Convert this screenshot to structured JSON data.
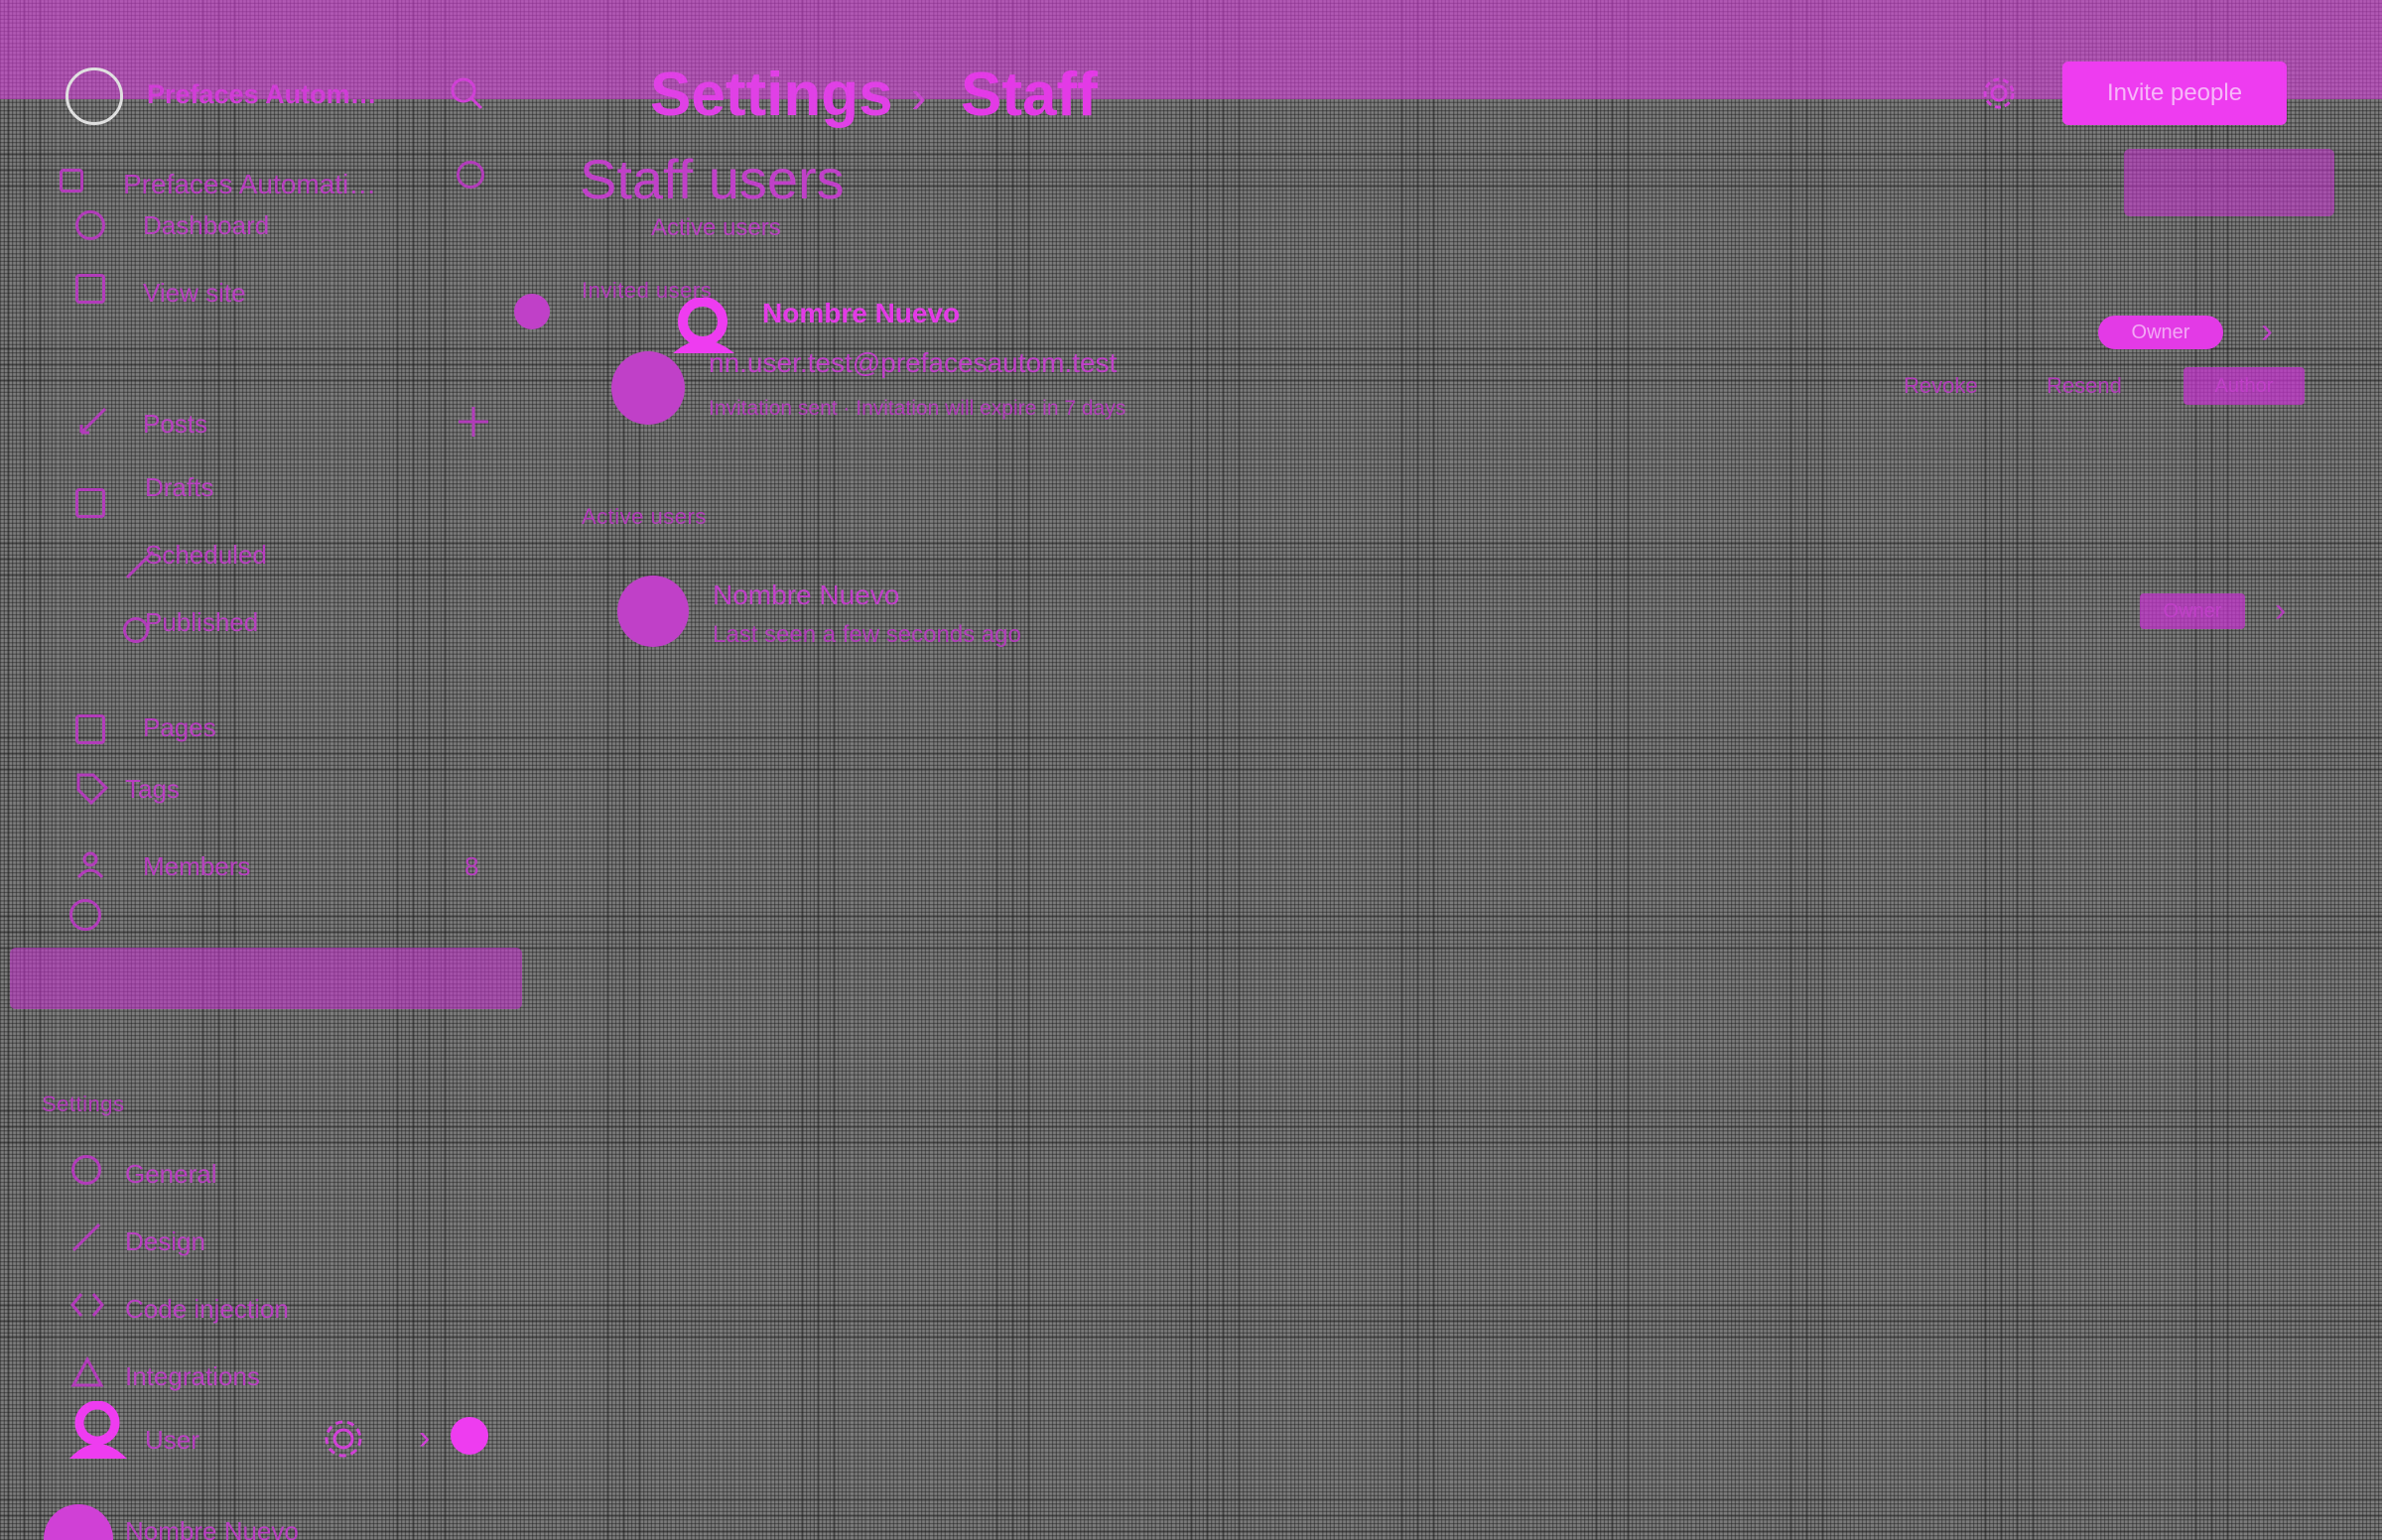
{
  "topbar": {
    "site_name": "Prefaces Autom…",
    "breadcrumb_parent": "Settings",
    "breadcrumb_separator": "›",
    "breadcrumb_current": "Staff",
    "invite_button": "Invite people"
  },
  "sidebar": {
    "site_name": "Prefaces Automati…",
    "dashboard": "Dashboard",
    "view_site": "View site",
    "posts_header": "Posts",
    "drafts": "Drafts",
    "scheduled": "Scheduled",
    "published": "Published",
    "pages": "Pages",
    "tags": "Tags",
    "members": "Members",
    "members_count": "8",
    "settings_header": "Settings",
    "general": "General",
    "design": "Design",
    "code_injection": "Code injection",
    "integrations": "Integrations",
    "user_label": "User",
    "bottom_user": "Nombre Nuevo"
  },
  "main": {
    "title": "Staff users",
    "subtitle": "Active users",
    "invited_section": "Invited users",
    "invited_user": {
      "name": "Nombre Nuevo",
      "email": "nn.user.test@prefacesautom.test",
      "detail": "Invitation sent · Invitation will expire in 7 days",
      "badge": "Owner",
      "revoke": "Revoke",
      "resend": "Resend",
      "role": "Author"
    },
    "active_section": "Active users",
    "active_user": {
      "name": "Nombre Nuevo",
      "detail": "Last seen a few seconds ago",
      "badge": "Owner"
    }
  },
  "colors": {
    "accent": "#e33ae6",
    "background": "#7d7d7d"
  }
}
